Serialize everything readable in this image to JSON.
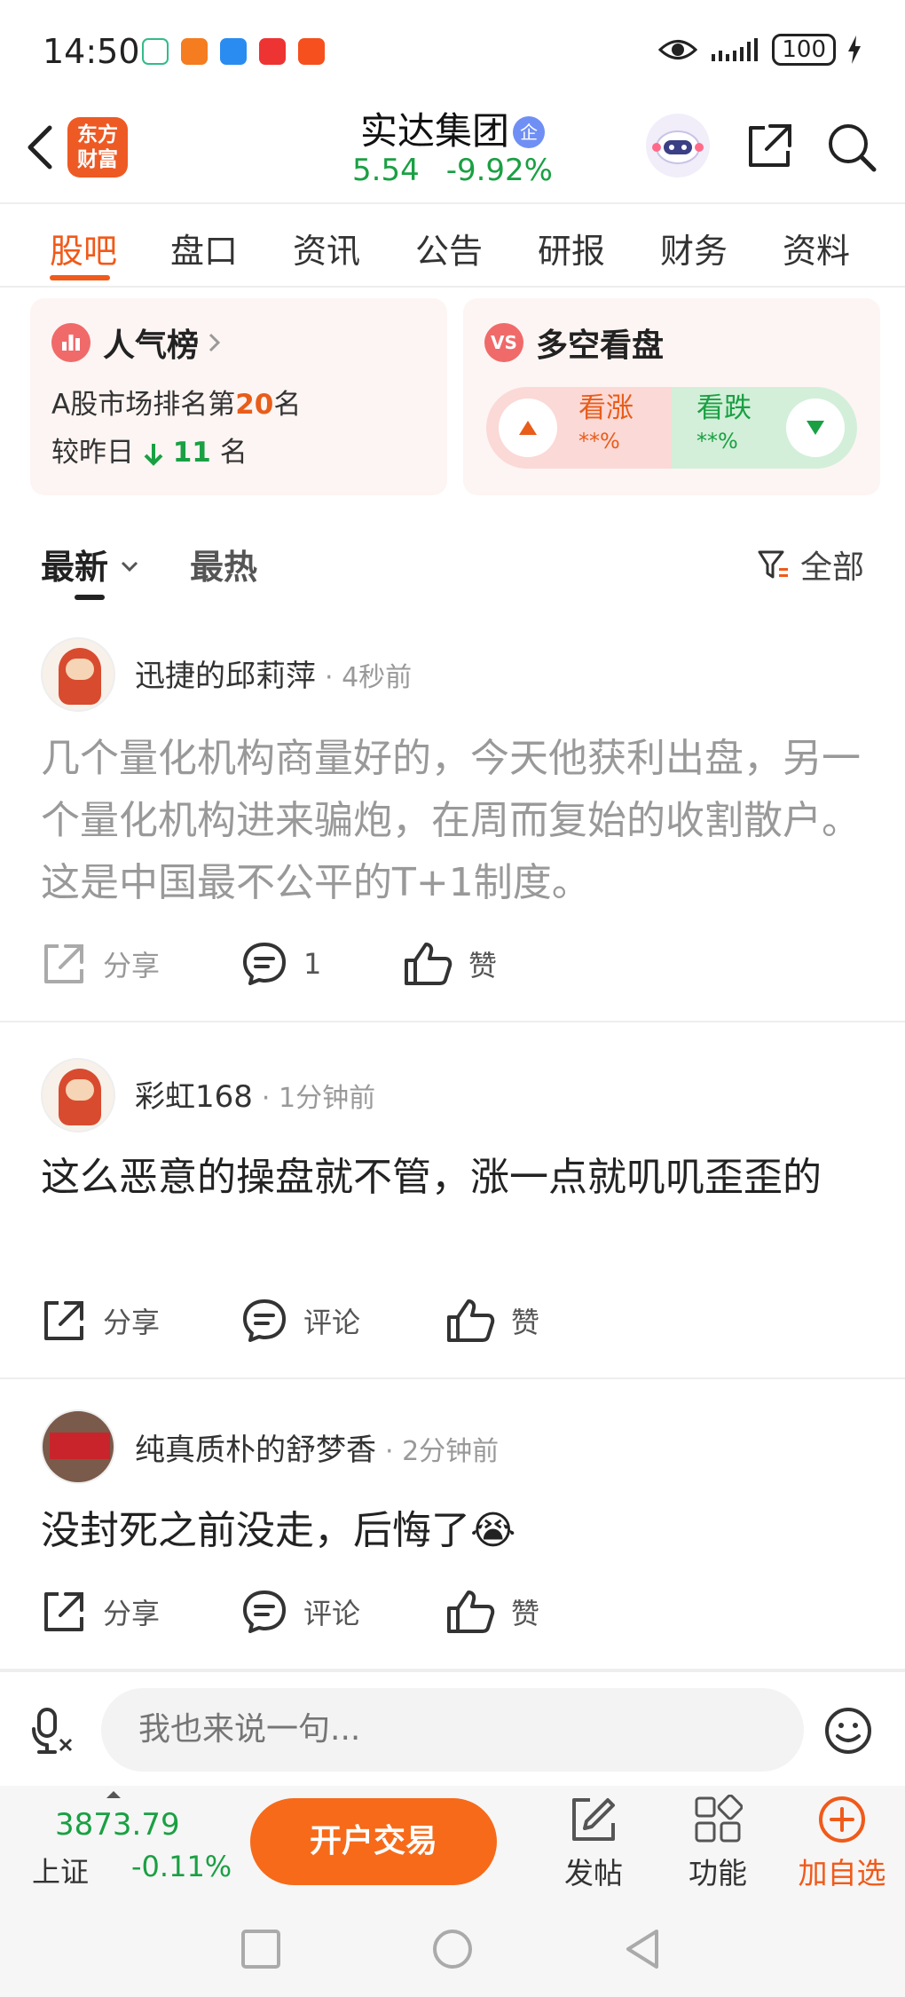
{
  "status_bar": {
    "time": "14:50",
    "battery": "100",
    "notification_icons": [
      "home-icon",
      "orange-app-icon",
      "weather-icon",
      "clown-app-icon",
      "airplane-app-icon"
    ]
  },
  "header": {
    "app_logo_text": "东方财富",
    "stock_name": "实达集团",
    "badge": "企",
    "price": "5.54",
    "change_pct": "-9.92%"
  },
  "tabs": [
    {
      "label": "股吧",
      "active": true
    },
    {
      "label": "盘口"
    },
    {
      "label": "资讯"
    },
    {
      "label": "公告"
    },
    {
      "label": "研报"
    },
    {
      "label": "财务"
    },
    {
      "label": "资料"
    }
  ],
  "popularity_card": {
    "title": "人气榜",
    "rank_prefix": "A股市场排名第",
    "rank": "20",
    "rank_suffix": "名",
    "compare_prefix": "较昨日",
    "compare_change": "11",
    "compare_suffix": "名"
  },
  "bull_bear_card": {
    "title": "多空看盘",
    "icon_text": "VS",
    "up_label": "看涨",
    "up_pct": "**%",
    "down_label": "看跌",
    "down_pct": "**%"
  },
  "sort": {
    "latest": "最新",
    "hot": "最热",
    "filter": "全部"
  },
  "posts": [
    {
      "author": "迅捷的邱莉萍",
      "time": "· 4秒前",
      "body": "几个量化机构商量好的，今天他获利出盘，另一个量化机构进来骗炮，在周而复始的收割散户。这是中国最不公平的T+1制度。",
      "share": "分享",
      "comment": "1",
      "like": "赞"
    },
    {
      "author": "彩虹168",
      "time": "· 1分钟前",
      "body": "这么恶意的操盘就不管，涨一点就叽叽歪歪的",
      "share": "分享",
      "comment": "评论",
      "like": "赞"
    },
    {
      "author": "纯真质朴的舒梦香",
      "time": "· 2分钟前",
      "body": "没封死之前没走，后悔了😭",
      "share": "分享",
      "comment": "评论",
      "like": "赞"
    }
  ],
  "comment_bar": {
    "placeholder": "我也来说一句..."
  },
  "toolbar": {
    "index_value": "3873.79",
    "index_name": "上证",
    "index_change": "-0.11%",
    "trade_button": "开户交易",
    "post_label": "发帖",
    "function_label": "功能",
    "add_watch_label": "加自选"
  },
  "colors": {
    "accent": "#f05a1a",
    "down_green": "#1aa043",
    "trade_button": "#f66a1a"
  }
}
